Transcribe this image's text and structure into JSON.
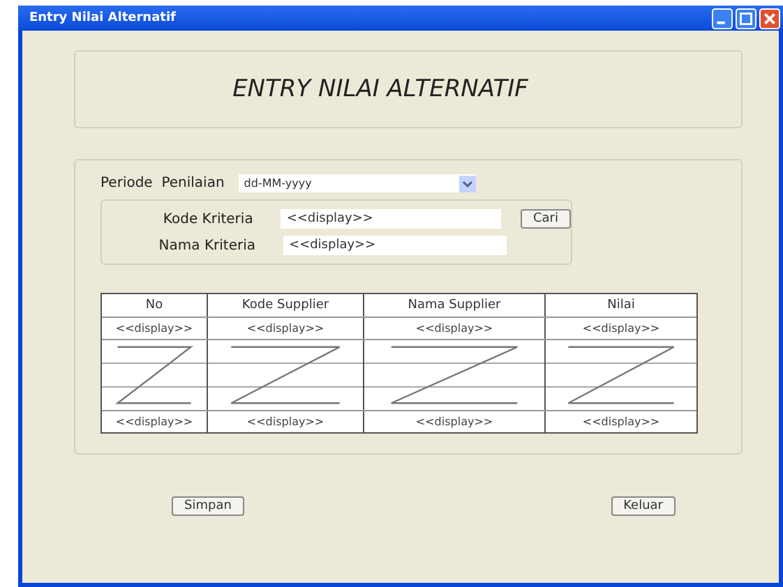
{
  "window": {
    "title": "Entry Nilai Alternatif"
  },
  "header": {
    "title": "ENTRY NILAI ALTERNATIF"
  },
  "periode": {
    "label": "Periode  Penilaian",
    "value": "dd-MM-yyyy"
  },
  "criteria": [
    {
      "label": "Kode Kriteria",
      "value": "<<display>>"
    },
    {
      "label": "Nama Kriteria",
      "value": "<<display>>"
    }
  ],
  "search_button": "Cari",
  "table": {
    "columns": [
      "No",
      "Kode Supplier",
      "Nama Supplier",
      "Nilai"
    ],
    "rows": [
      {
        "kind": "text",
        "cells": [
          "<<display>>",
          "<<display>>",
          "<<display>>",
          "<<display>>"
        ]
      },
      {
        "kind": "continuation"
      },
      {
        "kind": "text",
        "cells": [
          "<<display>>",
          "<<display>>",
          "<<display>>",
          "<<display>>"
        ]
      }
    ]
  },
  "buttons": [
    "Simpan",
    "Keluar"
  ]
}
